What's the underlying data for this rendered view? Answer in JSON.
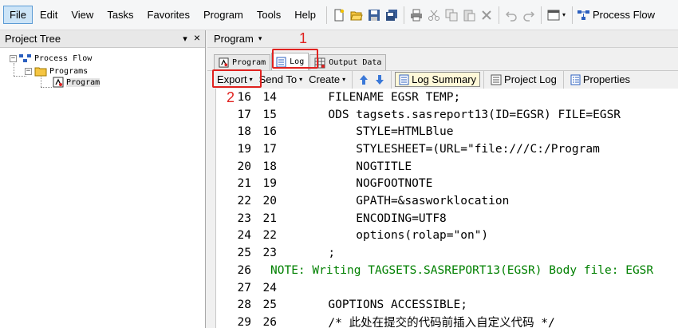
{
  "menu": [
    "File",
    "Edit",
    "View",
    "Tasks",
    "Favorites",
    "Program",
    "Tools",
    "Help"
  ],
  "toolbar": {
    "process_flow_label": "Process Flow"
  },
  "project_tree": {
    "title": "Project Tree",
    "pin": "▾",
    "close": "×",
    "items": [
      {
        "label": "Process Flow"
      },
      {
        "label": "Programs"
      },
      {
        "label": "Program"
      }
    ]
  },
  "program_header": {
    "label": "Program",
    "arrow": "▾"
  },
  "tabs": [
    {
      "label": "Program"
    },
    {
      "label": "Log"
    },
    {
      "label": "Output Data"
    }
  ],
  "log_toolbar": {
    "export": "Export",
    "send_to": "Send To",
    "create": "Create",
    "log_summary": "Log Summary",
    "project_log": "Project Log",
    "properties": "Properties",
    "dropdown_arrow": "▾"
  },
  "annotations": {
    "one": "1",
    "two": "2"
  },
  "code_lines": [
    {
      "line": "16",
      "src": "14",
      "text": "      FILENAME EGSR TEMP;",
      "kind": "code"
    },
    {
      "line": "17",
      "src": "15",
      "text": "      ODS tagsets.sasreport13(ID=EGSR) FILE=EGSR",
      "kind": "code"
    },
    {
      "line": "18",
      "src": "16",
      "text": "          STYLE=HTMLBlue",
      "kind": "code"
    },
    {
      "line": "19",
      "src": "17",
      "text": "          STYLESHEET=(URL=\"file:///C:/Program",
      "kind": "code"
    },
    {
      "line": "20",
      "src": "18",
      "text": "          NOGTITLE",
      "kind": "code"
    },
    {
      "line": "21",
      "src": "19",
      "text": "          NOGFOOTNOTE",
      "kind": "code"
    },
    {
      "line": "22",
      "src": "20",
      "text": "          GPATH=&sasworklocation",
      "kind": "code"
    },
    {
      "line": "23",
      "src": "21",
      "text": "          ENCODING=UTF8",
      "kind": "code"
    },
    {
      "line": "24",
      "src": "22",
      "text": "          options(rolap=\"on\")",
      "kind": "code"
    },
    {
      "line": "25",
      "src": "23",
      "text": "      ;",
      "kind": "code"
    },
    {
      "line": "26",
      "src": "",
      "text": "NOTE: Writing TAGSETS.SASREPORT13(EGSR) Body file: EGSR",
      "kind": "note"
    },
    {
      "line": "27",
      "src": "24",
      "text": "",
      "kind": "code"
    },
    {
      "line": "28",
      "src": "25",
      "text": "      GOPTIONS ACCESSIBLE;",
      "kind": "code"
    },
    {
      "line": "29",
      "src": "26",
      "text": "      /* 此处在提交的代码前插入自定义代码 */",
      "kind": "code"
    }
  ]
}
